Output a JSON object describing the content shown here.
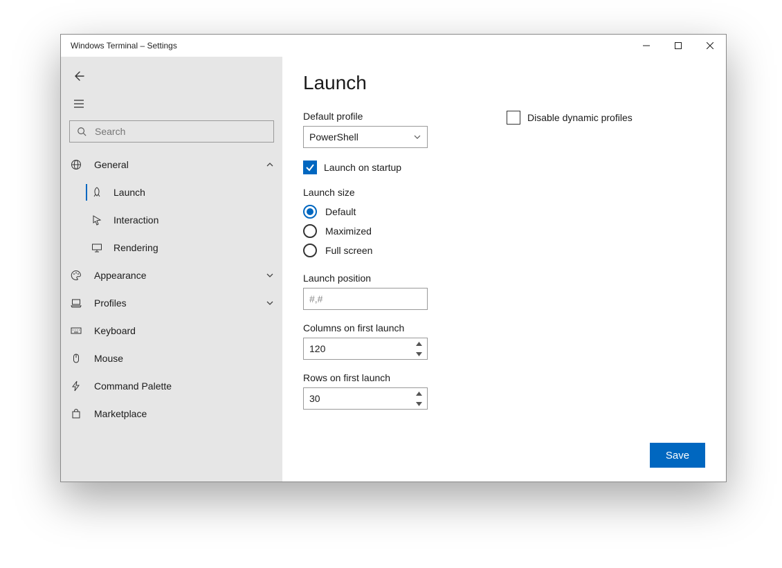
{
  "window": {
    "title": "Windows Terminal – Settings"
  },
  "sidebar": {
    "search_placeholder": "Search",
    "items": [
      {
        "key": "general",
        "label": "General",
        "expandable": true,
        "expanded": true
      },
      {
        "key": "appearance",
        "label": "Appearance",
        "expandable": true,
        "expanded": false
      },
      {
        "key": "profiles",
        "label": "Profiles",
        "expandable": true,
        "expanded": false
      },
      {
        "key": "keyboard",
        "label": "Keyboard",
        "expandable": false
      },
      {
        "key": "mouse",
        "label": "Mouse",
        "expandable": false
      },
      {
        "key": "command_palette",
        "label": "Command Palette",
        "expandable": false
      },
      {
        "key": "marketplace",
        "label": "Marketplace",
        "expandable": false
      }
    ],
    "general_sub": [
      {
        "key": "launch",
        "label": "Launch",
        "active": true
      },
      {
        "key": "interaction",
        "label": "Interaction",
        "active": false
      },
      {
        "key": "rendering",
        "label": "Rendering",
        "active": false
      }
    ]
  },
  "content": {
    "title": "Launch",
    "default_profile_label": "Default profile",
    "default_profile_value": "PowerShell",
    "disable_dynamic_label": "Disable dynamic profiles",
    "disable_dynamic_checked": false,
    "launch_on_startup_label": "Launch on startup",
    "launch_on_startup_checked": true,
    "launch_size_label": "Launch size",
    "launch_size_options": [
      "Default",
      "Maximized",
      "Full screen"
    ],
    "launch_size_selected": "Default",
    "launch_position_label": "Launch position",
    "launch_position_placeholder": "#,#",
    "launch_position_value": "",
    "columns_label": "Columns on first launch",
    "columns_value": "120",
    "rows_label": "Rows on first launch",
    "rows_value": "30",
    "save_button": "Save"
  }
}
